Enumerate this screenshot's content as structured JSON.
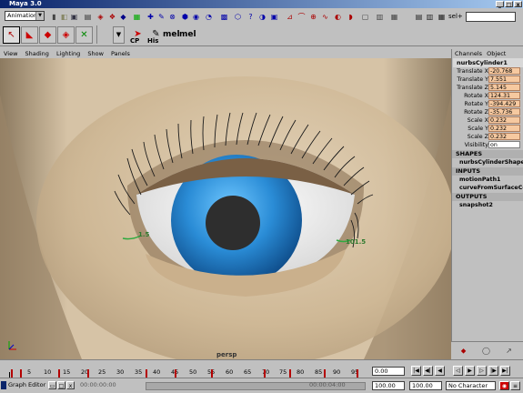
{
  "window": {
    "title": "Maya 3.0",
    "min": "_",
    "max": "□",
    "close": "x"
  },
  "status": {
    "menu_set": "Animation",
    "sel_field": "sel+"
  },
  "shelf": {
    "label_cp": "CP",
    "label_his": "His",
    "label_mel1": "mel",
    "label_mel2": "mel"
  },
  "panel_menu": [
    "View",
    "Shading",
    "Lighting",
    "Show",
    "Panels"
  ],
  "viewport": {
    "camera": "persp",
    "curve_label_left": "1.5",
    "curve_label_right": "101.5",
    "colors": {
      "skin": "#d6c3a6",
      "iris": "#2a8cd6",
      "pupil": "#2e2e2e",
      "sclera": "#f7f7f7",
      "curve": "#2faa40"
    }
  },
  "channel_box": {
    "tabs": [
      "Channels",
      "Object"
    ],
    "node": "nurbsCylinder1",
    "attributes": [
      {
        "label": "Translate X",
        "value": "-20.768"
      },
      {
        "label": "Translate Y",
        "value": "7.551"
      },
      {
        "label": "Translate Z",
        "value": "5.145"
      },
      {
        "label": "Rotate X",
        "value": "124.31"
      },
      {
        "label": "Rotate Y",
        "value": "-394.429"
      },
      {
        "label": "Rotate Z",
        "value": "-35.736"
      },
      {
        "label": "Scale X",
        "value": "0.232"
      },
      {
        "label": "Scale Y",
        "value": "0.232"
      },
      {
        "label": "Scale Z",
        "value": "0.232"
      },
      {
        "label": "Visibility",
        "value": "on"
      }
    ],
    "shapes_header": "SHAPES",
    "shapes": [
      "nurbsCylinderShape1"
    ],
    "inputs_header": "INPUTS",
    "inputs": [
      "motionPath1",
      "curveFromSurfaceCo"
    ],
    "outputs_header": "OUTPUTS",
    "outputs": [
      "snapshot2"
    ]
  },
  "timeline": {
    "ticks": [
      "5",
      "10",
      "15",
      "20",
      "25",
      "30",
      "35",
      "40",
      "45",
      "50",
      "55",
      "60",
      "65",
      "70",
      "75",
      "80",
      "85",
      "90",
      "95"
    ],
    "current_frame": "0.00"
  },
  "range": {
    "start": "0.00",
    "end": "100.00",
    "range_end": "100.00",
    "character": "No Character",
    "taskbar_label": "Graph Editor",
    "time_readout": "00:00:00:00",
    "time_readout2": "00:00:04:00"
  }
}
